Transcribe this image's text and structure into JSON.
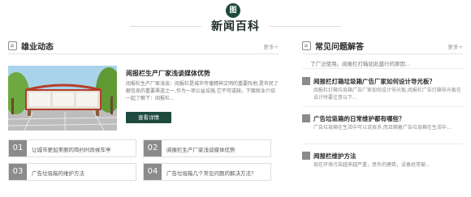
{
  "header": {
    "title": "新闻百科",
    "logo": "news-logo-icon"
  },
  "left": {
    "title": "雄业动态",
    "more": "更多+",
    "feature": {
      "title": "阅报栏生产厂家浅谈媒体优势",
      "desc": "阅报栏生产厂家浅谈：阅报栏是城市传播精神文明的重要阵地,是市民了解信息的重要渠道之一,作为一项公益设施,它不可或缺。下面就业介绍一起了解下：阅报栏...",
      "button": "查看详情"
    },
    "items": [
      {
        "num": "01",
        "text": "让城市更加美丽的简约时尚候车亭"
      },
      {
        "num": "02",
        "text": "阅报栏生产厂家浅谈媒体优势"
      },
      {
        "num": "03",
        "text": "广告垃圾箱的维护方法"
      },
      {
        "num": "04",
        "text": "广告垃圾箱几个常见问题的解决方法？"
      }
    ]
  },
  "right": {
    "title": "常见问题解答",
    "more": "更多+",
    "first": "了广泛使用。阅报栏灯箱如此盛行的原因...",
    "qas": [
      {
        "title": "阅报栏灯箱垃圾箱广告厂家如何设计导光板？",
        "desc": "阅报栏灯箱垃圾箱广告厂家如何设计导光板,阅报栏广告灯箱导光板在设计时要注意以下..."
      },
      {
        "title": "广告垃圾箱的日常维护都有哪些？",
        "desc": "广告垃圾箱在生活中可以说很多,而且随着广告垃圾箱在生活中..."
      },
      {
        "title": "阅报栏维护方法",
        "desc": "现在环境污染越来越严重，意外的建筑，设备经常被..."
      }
    ]
  },
  "colors": {
    "accent": "#1f4a3e",
    "badge": "#8b8b8b"
  }
}
